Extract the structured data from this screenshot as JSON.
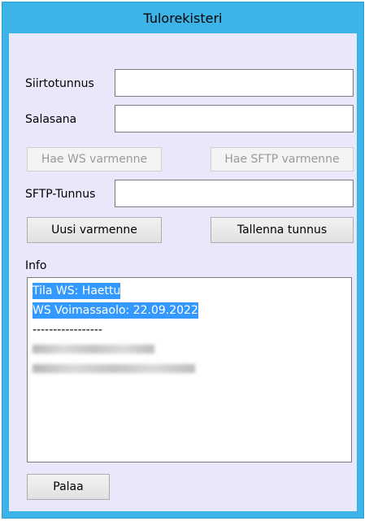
{
  "window": {
    "title": "Tulorekisteri"
  },
  "form": {
    "siirtotunnus_label": "Siirtotunnus",
    "siirtotunnus_value": "",
    "salasana_label": "Salasana",
    "salasana_value": "",
    "hae_ws_label": "Hae WS varmenne",
    "hae_sftp_label": "Hae SFTP varmenne",
    "sftp_tunnus_label": "SFTP-Tunnus",
    "sftp_tunnus_value": "",
    "uusi_varmenne_label": "Uusi varmenne",
    "tallenna_tunnus_label": "Tallenna tunnus",
    "info_label": "Info",
    "palaa_label": "Palaa"
  },
  "info": {
    "lines": [
      "Tila WS: Haettu",
      "WS Voimassaolo: 22.09.2022",
      "-----------------"
    ]
  },
  "colors": {
    "titlebar": "#3cb4e8",
    "client_bg": "#e8e8fa",
    "selection": "#3399ff"
  }
}
